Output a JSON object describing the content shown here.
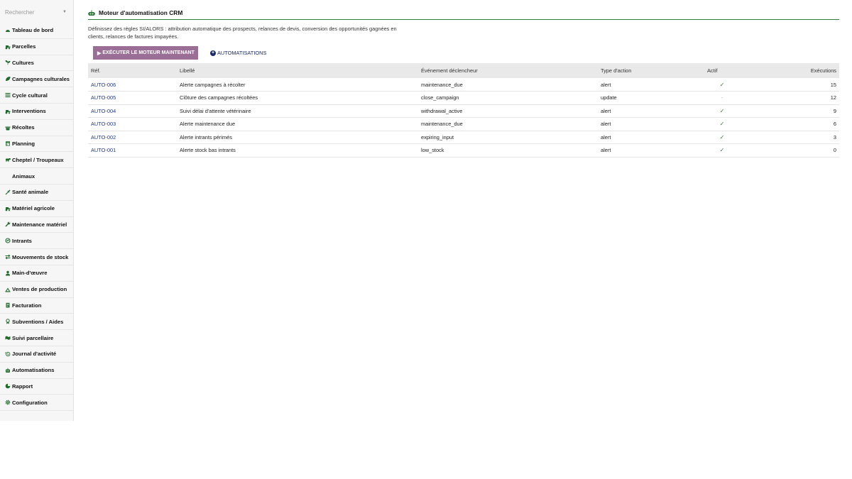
{
  "search": {
    "placeholder": "Rechercher"
  },
  "sidebar": {
    "items": [
      {
        "label": "Tableau de bord",
        "icon": "dashboard-icon"
      },
      {
        "label": "Parcelles",
        "icon": "tractor-icon"
      },
      {
        "label": "Cultures",
        "icon": "seedling-icon"
      },
      {
        "label": "Campagnes culturales",
        "icon": "leaf-icon"
      },
      {
        "label": "Cycle cultural",
        "icon": "list-icon"
      },
      {
        "label": "Interventions",
        "icon": "tractor-icon"
      },
      {
        "label": "Récoltes",
        "icon": "basket-icon"
      },
      {
        "label": "Planning",
        "icon": "calendar-icon"
      },
      {
        "label": "Cheptel / Troupeaux",
        "icon": "cow-icon"
      },
      {
        "label": "Animaux",
        "icon": ""
      },
      {
        "label": "Santé animale",
        "icon": "syringe-icon"
      },
      {
        "label": "Matériel agricole",
        "icon": "tractor-icon"
      },
      {
        "label": "Maintenance matériel",
        "icon": "wrench-icon"
      },
      {
        "label": "Intrants",
        "icon": "flask-icon"
      },
      {
        "label": "Mouvements de stock",
        "icon": "exchange-icon"
      },
      {
        "label": "Main-d'œuvre",
        "icon": "user-icon"
      },
      {
        "label": "Ventes de production",
        "icon": "truck-icon"
      },
      {
        "label": "Facturation",
        "icon": "invoice-icon"
      },
      {
        "label": "Subventions / Aides",
        "icon": "award-icon"
      },
      {
        "label": "Suivi parcellaire",
        "icon": "map-icon"
      },
      {
        "label": "Journal d'activité",
        "icon": "history-icon"
      },
      {
        "label": "Automatisations",
        "icon": "robot-icon"
      },
      {
        "label": "Rapport",
        "icon": "chart-icon"
      },
      {
        "label": "Configuration",
        "icon": "gear-icon"
      }
    ]
  },
  "header": {
    "title": "Moteur d'automatisation CRM",
    "description": "Définissez des règles SI/ALORS : attribution automatique des prospects, relances de devis, conversion des opportunités gagnées en clients, relances de factures impayées."
  },
  "actions": {
    "run_label": "EXÉCUTER LE MOTEUR MAINTENANT",
    "automations_label": "AUTOMATISATIONS"
  },
  "table": {
    "columns": [
      "Réf.",
      "Libellé",
      "Événement déclencheur",
      "Type d'action",
      "Actif",
      "Exécutions"
    ],
    "rows": [
      {
        "ref": "AUTO-006",
        "label": "Alerte campagnes à récolter",
        "event": "maintenance_due",
        "action": "alert",
        "active": "✓",
        "runs": "15"
      },
      {
        "ref": "AUTO-005",
        "label": "Clôture des campagnes récoltées",
        "event": "close_campaign",
        "action": "update",
        "active": "-",
        "runs": "12"
      },
      {
        "ref": "AUTO-004",
        "label": "Suivi délai d'attente vétérinaire",
        "event": "withdrawal_active",
        "action": "alert",
        "active": "✓",
        "runs": "9"
      },
      {
        "ref": "AUTO-003",
        "label": "Alerte maintenance due",
        "event": "maintenance_due",
        "action": "alert",
        "active": "✓",
        "runs": "6"
      },
      {
        "ref": "AUTO-002",
        "label": "Alerte intrants périmés",
        "event": "expiring_input",
        "action": "alert",
        "active": "✓",
        "runs": "3"
      },
      {
        "ref": "AUTO-001",
        "label": "Alerte stock bas intrants",
        "event": "low_stock",
        "action": "alert",
        "active": "✓",
        "runs": "0"
      }
    ]
  },
  "colors": {
    "accent": "#2f7d3a",
    "button": "#9b6f95",
    "link": "#1e3a8a"
  }
}
